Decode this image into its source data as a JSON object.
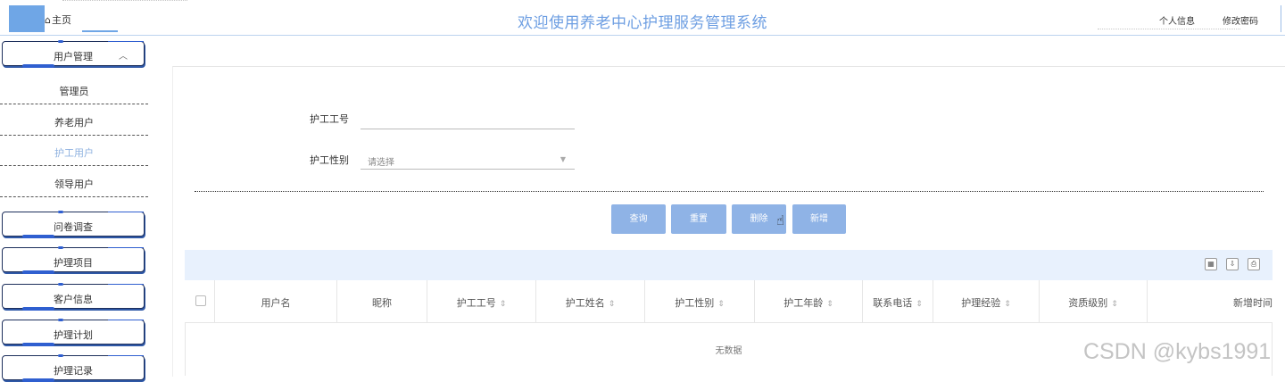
{
  "header": {
    "home_tab": "主页",
    "title": "欢迎使用养老中心护理服务管理系统",
    "profile_link": "个人信息",
    "password_link": "修改密码"
  },
  "sidebar": {
    "user_menu": {
      "label": "用户管理",
      "items": [
        "管理员",
        "养老用户",
        "护工用户",
        "领导用户"
      ],
      "active": "护工用户"
    },
    "menus": [
      "问卷调查",
      "护理项目",
      "客户信息",
      "护理计划",
      "护理记录"
    ]
  },
  "search_form": {
    "worker_no_label": "护工工号",
    "worker_no_value": "",
    "worker_gender_label": "护工性别",
    "worker_gender_placeholder": "请选择"
  },
  "actions": {
    "query": "查询",
    "reset": "重置",
    "delete": "删除",
    "add": "新增"
  },
  "table": {
    "columns": [
      "用户名",
      "昵称",
      "护工工号",
      "护工姓名",
      "护工性别",
      "护工年龄",
      "联系电话",
      "护理经验",
      "资质级别",
      "新增时间"
    ],
    "sortable": [
      "护工工号",
      "护工姓名",
      "护工性别",
      "护工年龄",
      "联系电话",
      "护理经验",
      "资质级别"
    ],
    "empty_text": "无数据",
    "toolbar_icons": [
      "columns-icon",
      "export-icon",
      "print-icon"
    ]
  },
  "watermark": "CSDN @kybs1991",
  "colors": {
    "title": "#6d9ee2",
    "button": "#8fb3e6",
    "table_bar": "#e8f1fd",
    "menu_border": "#1d2f5c",
    "menu_accent": "#2f5fd0"
  }
}
